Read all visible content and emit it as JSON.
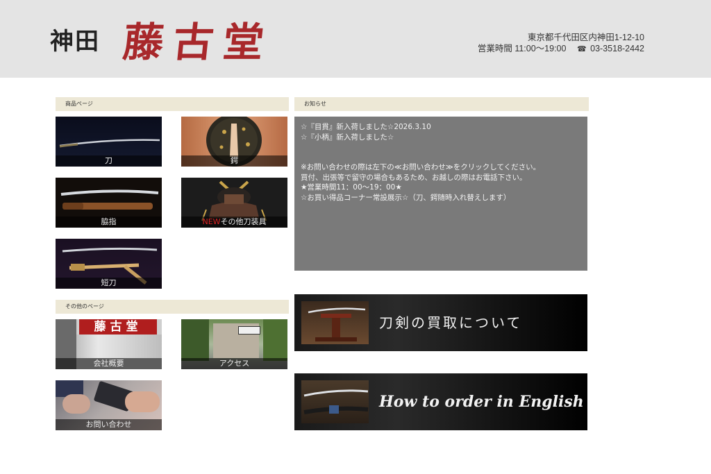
{
  "header": {
    "logo_prefix": "神田",
    "logo_main": "藤古堂",
    "address": "東京都千代田区内神田1-12-10",
    "hours": "営業時間 11:00～19:00",
    "phone": "03-3518-2442"
  },
  "products": {
    "title": "商品ページ",
    "tiles": [
      {
        "label": "刀"
      },
      {
        "label": "鍔"
      },
      {
        "label": "脇指"
      },
      {
        "new_badge": "NEW",
        "label": "その他刀装具"
      },
      {
        "label": "短刀"
      }
    ]
  },
  "other": {
    "title": "その他のページ",
    "tiles": [
      {
        "label": "会社概要",
        "sign": "藤古堂"
      },
      {
        "label": "アクセス"
      },
      {
        "label": "お問い合わせ"
      }
    ]
  },
  "news": {
    "title": "お知らせ",
    "lines": [
      "☆『目貫』新入荷しました☆2026.3.10",
      "☆『小柄』新入荷しました☆",
      "",
      "",
      "※お問い合わせの際は左下の≪お問い合わせ≫をクリックしてください。",
      "買付、出張等で留守の場合もあるため、お越しの際はお電話下さい。",
      "★営業時間11：00～19：00★",
      "☆お買い得品コーナー常設展示☆（刀、鍔随時入れ替えします）"
    ]
  },
  "banners": {
    "purchase": "刀剣の買取について",
    "english": "How to order in English"
  },
  "colors": {
    "logo_red": "#a8282b",
    "header_bg": "#e4e4e4",
    "section_bar": "#ede8d6",
    "news_bg": "#7a7a7a"
  }
}
